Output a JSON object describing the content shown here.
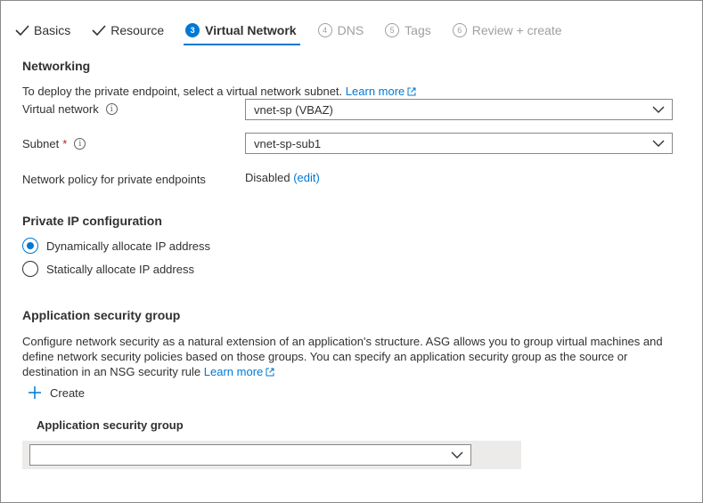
{
  "steps": [
    {
      "label": "Basics",
      "state": "done"
    },
    {
      "label": "Resource",
      "state": "done"
    },
    {
      "label": "Virtual Network",
      "state": "active",
      "number": "3"
    },
    {
      "label": "DNS",
      "state": "disabled",
      "number": "4"
    },
    {
      "label": "Tags",
      "state": "disabled",
      "number": "5"
    },
    {
      "label": "Review + create",
      "state": "disabled",
      "number": "6"
    }
  ],
  "networking": {
    "title": "Networking",
    "description": "To deploy the private endpoint, select a virtual network subnet.",
    "learn_more": "Learn more",
    "virtual_network_label": "Virtual network",
    "virtual_network_value": "vnet-sp (VBAZ)",
    "subnet_label": "Subnet",
    "required_mark": "*",
    "subnet_value": "vnet-sp-sub1",
    "policy_label": "Network policy for private endpoints",
    "policy_value": "Disabled",
    "policy_edit": "(edit)"
  },
  "private_ip": {
    "title": "Private IP configuration",
    "options": [
      {
        "label": "Dynamically allocate IP address",
        "checked": true
      },
      {
        "label": "Statically allocate IP address",
        "checked": false
      }
    ]
  },
  "asg": {
    "title": "Application security group",
    "description_line1": "Configure network security as a natural extension of an application's structure. ASG allows you to group virtual machines and",
    "description_line2": "define network security policies based on those groups. You can specify an application security group as the source or",
    "description_line3": "destination in an NSG security rule",
    "learn_more": "Learn more",
    "create_label": "Create",
    "column_header": "Application security group",
    "dropdown_value": ""
  },
  "colors": {
    "accent": "#0078d4",
    "required": "#a4262c",
    "disabled": "#a19f9d"
  }
}
